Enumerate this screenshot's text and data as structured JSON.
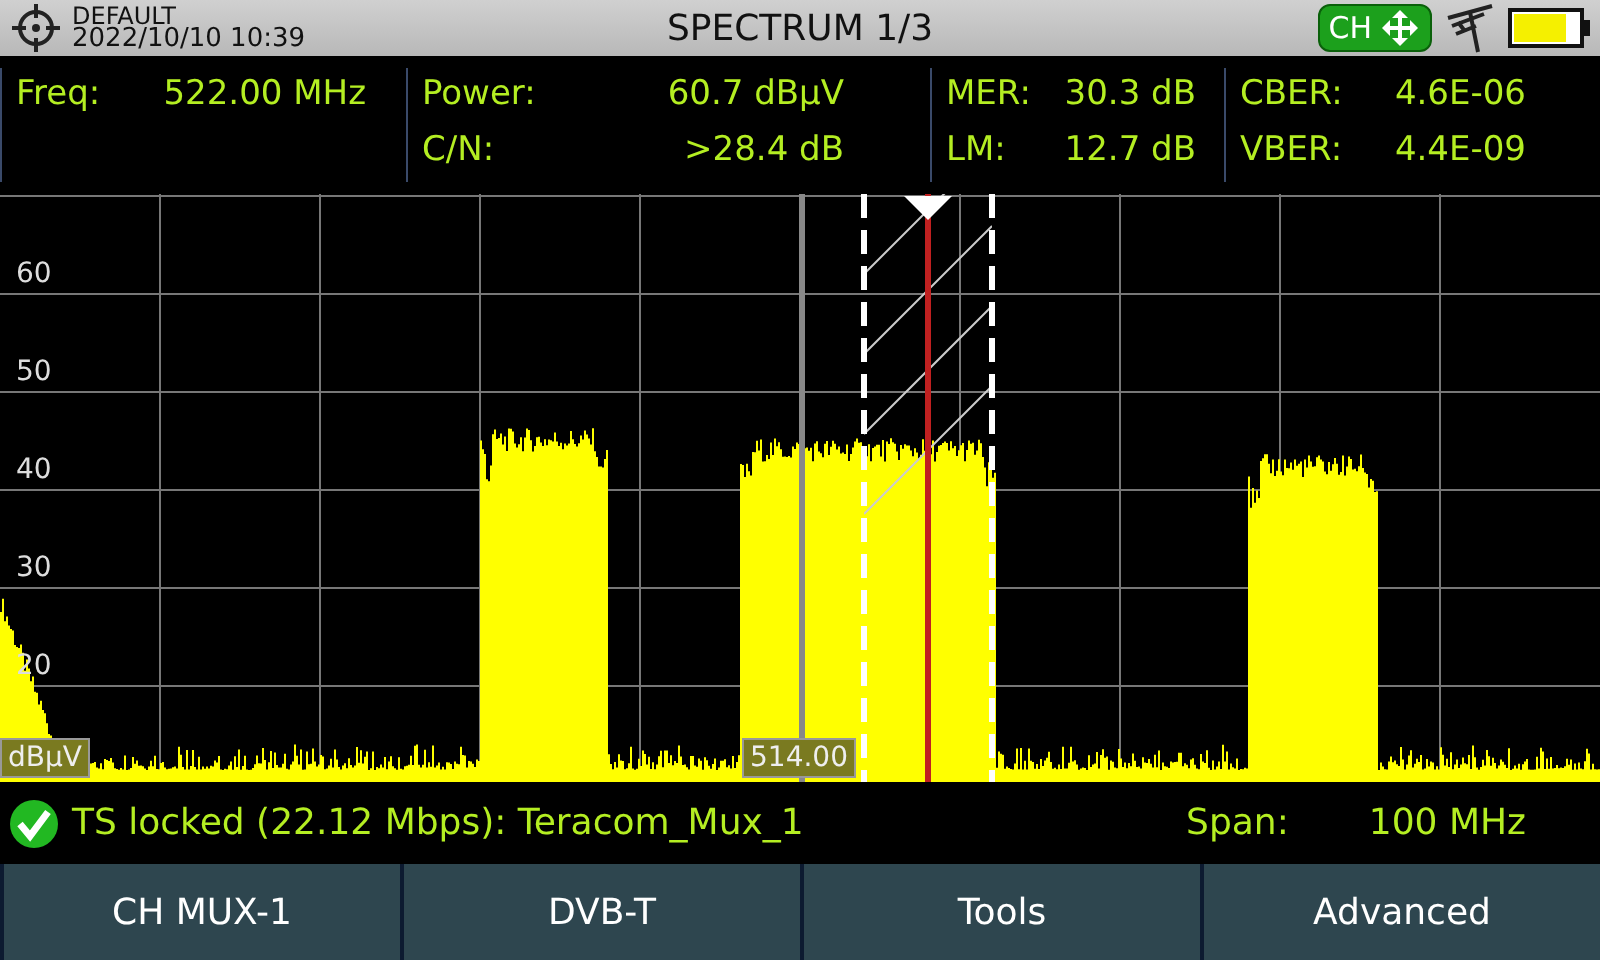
{
  "header": {
    "profile": "DEFAULT",
    "datetime": "2022/10/10 10:39",
    "title": "SPECTRUM 1/3",
    "ch_badge": "CH"
  },
  "measurements": [
    [
      {
        "label": "Freq:",
        "value": "522.00 MHz"
      }
    ],
    [
      {
        "label": "Power:",
        "value": "60.7 dBµV"
      },
      {
        "label": "C/N:",
        "value": ">28.4 dB"
      }
    ],
    [
      {
        "label": "MER:",
        "value": "30.3 dB"
      },
      {
        "label": "LM:",
        "value": "12.7 dB"
      }
    ],
    [
      {
        "label": "CBER:",
        "value": "4.6E-06"
      },
      {
        "label": "VBER:",
        "value": "4.4E-09"
      }
    ]
  ],
  "spectrum": {
    "y_labels": [
      "60",
      "50",
      "40",
      "30",
      "20"
    ],
    "unit": "dBµV",
    "marker_label": "514.00"
  },
  "status": {
    "locked": true,
    "text": "TS locked (22.12 Mbps): Teracom_Mux_1",
    "span_label": "Span:",
    "span_value": "100 MHz"
  },
  "softkeys": [
    "CH MUX-1",
    "DVB-T",
    "Tools",
    "Advanced"
  ]
}
